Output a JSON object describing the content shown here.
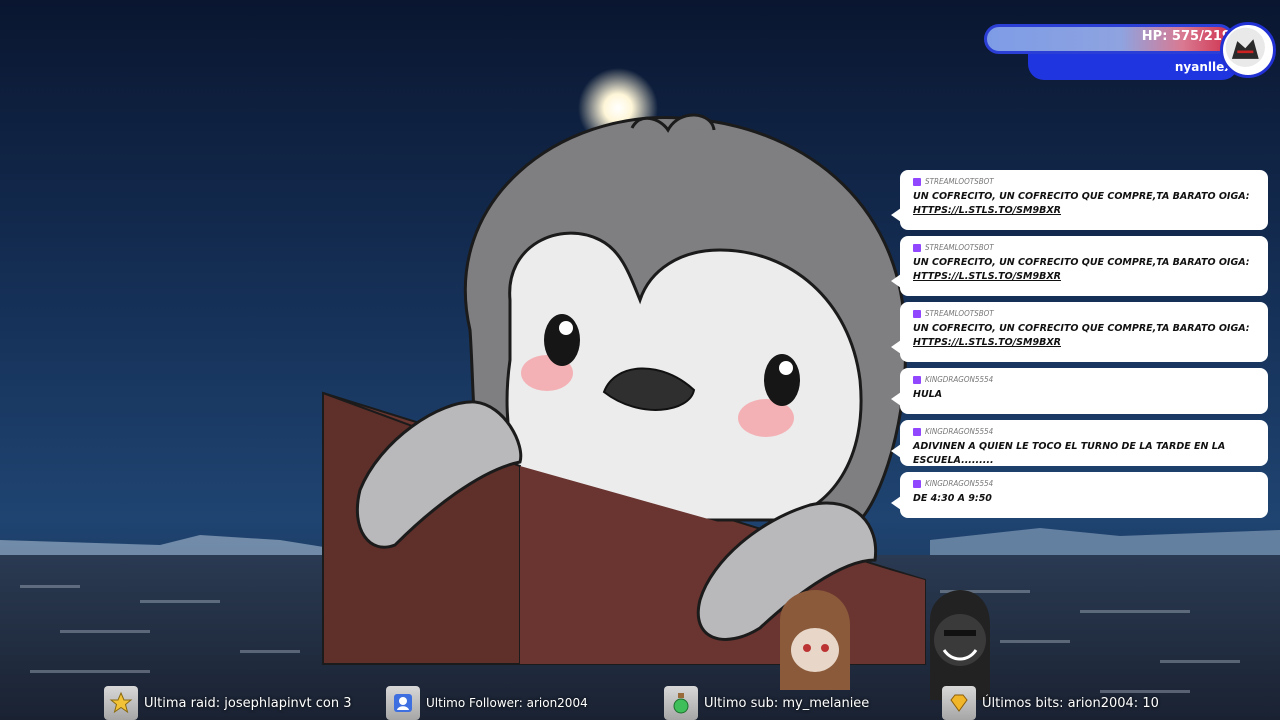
{
  "overlay": {
    "hp_text": "HP: 575/2192",
    "username": "nyanllex",
    "colors": {
      "hp_border": "#2b3fd6",
      "name_bar": "#1f35e0",
      "hp_fill_end": "#d0314d"
    }
  },
  "chat": {
    "messages": [
      {
        "user": "StreamlootsBot",
        "text": "UN COFRECITO, UN COFRECITO QUE COMPRE,TA BARATO OIGA:",
        "link": "HTTPS://L.STLS.TO/SM9BXR"
      },
      {
        "user": "StreamlootsBot",
        "text": "UN COFRECITO, UN COFRECITO QUE COMPRE,TA BARATO OIGA:",
        "link": "HTTPS://L.STLS.TO/SM9BXR"
      },
      {
        "user": "StreamlootsBot",
        "text": "UN COFRECITO, UN COFRECITO QUE COMPRE,TA BARATO OIGA:",
        "link": "HTTPS://L.STLS.TO/SM9BXR"
      },
      {
        "user": "kingdragon5554",
        "text": "HULA",
        "link": ""
      },
      {
        "user": "kingdragon5554",
        "text": "ADIVINEN A QUIEN LE TOCO EL TURNO DE LA TARDE EN LA ESCUELA.........",
        "link": ""
      },
      {
        "user": "kingdragon5554",
        "text": "DE 4:30 A 9:50",
        "link": ""
      }
    ]
  },
  "bottom_bar": {
    "raid": "Ultima raid: josephlapinvt con 3",
    "follower": "Ultimo Follower: arion2004",
    "sub": "Ultimo sub: my_melaniee",
    "bits": "Últimos bits: arion2004: 10"
  },
  "icons": [
    "star-icon",
    "follower-icon",
    "sub-potion-icon",
    "bits-gem-icon",
    "twitch-icon"
  ]
}
